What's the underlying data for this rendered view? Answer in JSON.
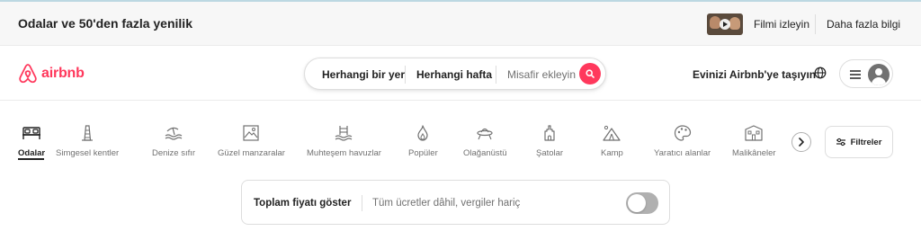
{
  "banner": {
    "title": "Odalar ve 50'den fazla yenilik",
    "watch_link": "Filmi izleyin",
    "learn_more_link": "Daha fazla bilgi"
  },
  "header": {
    "logo_text": "airbnb",
    "host_link": "Evinizi Airbnb'ye taşıyın"
  },
  "search": {
    "where": "Herhangi bir yer",
    "when": "Herhangi hafta",
    "guests": "Misafir ekleyin"
  },
  "categories": [
    {
      "label": "Odalar",
      "icon": "bed-icon",
      "active": true
    },
    {
      "label": "Simgesel kentler",
      "icon": "landmark-tower-icon",
      "active": false
    },
    {
      "label": "Denize sıfır",
      "icon": "beachfront-icon",
      "active": false
    },
    {
      "label": "Güzel manzaralar",
      "icon": "view-frame-icon",
      "active": false
    },
    {
      "label": "Muhteşem havuzlar",
      "icon": "pool-icon",
      "active": false
    },
    {
      "label": "Popüler",
      "icon": "flame-icon",
      "active": false
    },
    {
      "label": "Olağanüstü",
      "icon": "ufo-icon",
      "active": false
    },
    {
      "label": "Şatolar",
      "icon": "castle-icon",
      "active": false
    },
    {
      "label": "Kamp",
      "icon": "tent-icon",
      "active": false
    },
    {
      "label": "Yaratıcı alanlar",
      "icon": "palette-icon",
      "active": false
    },
    {
      "label": "Malikâneler",
      "icon": "mansion-icon",
      "active": false
    }
  ],
  "filters": {
    "label": "Filtreler"
  },
  "price_toggle": {
    "title": "Toplam fiyatı göster",
    "description": "Tüm ücretler dâhil, vergiler hariç",
    "enabled": false
  },
  "colors": {
    "brand": "#ff385c",
    "text": "#222222",
    "muted": "#717171",
    "border": "#dddddd"
  }
}
